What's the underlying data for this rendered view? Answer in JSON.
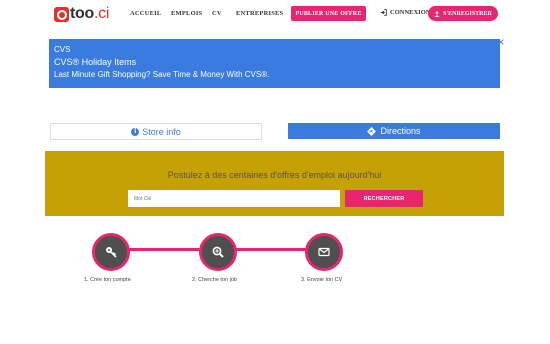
{
  "header": {
    "logo": "too",
    "logo_suffix": ".ci",
    "nav": [
      {
        "label": "ACCUEIL"
      },
      {
        "label": "EMPLOIS"
      },
      {
        "label": "CV"
      },
      {
        "label": "ENTREPRISES"
      }
    ],
    "publish_label": "PUBLIER UNE OFFRE",
    "login_label": "CONNEXION",
    "register_label": "S'ENREGISTRER"
  },
  "ad": {
    "brand": "CVS",
    "title": "CVS® Holiday Items",
    "description": "Last Minute Gift Shopping? Save Time & Money With CVS®.",
    "store_info_label": "Store info",
    "directions_label": "Directions"
  },
  "search": {
    "title": "Postulez à des centaines d'offres d'emploi aujourd'hui",
    "placeholder": "Mot Clé",
    "button_label": "RECHERCHER"
  },
  "steps": [
    {
      "label": "1. Crée ton compte",
      "icon": "key-icon"
    },
    {
      "label": "2. Cherche ton job",
      "icon": "search-icon"
    },
    {
      "label": "3. Envoie ton CV",
      "icon": "mail-icon"
    }
  ],
  "colors": {
    "accent": "#e8266f",
    "brand_red": "#e4312e",
    "band": "#c5a106",
    "ad_blue": "#3a7be0",
    "step_circle": "#4f4f50"
  }
}
